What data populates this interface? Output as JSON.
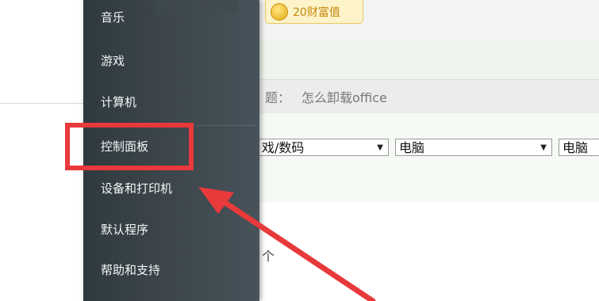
{
  "menu": {
    "items": [
      {
        "label": "音乐"
      },
      {
        "label": "游戏"
      },
      {
        "label": "计算机"
      },
      {
        "label": "控制面板"
      },
      {
        "label": "设备和打印机"
      },
      {
        "label": "默认程序"
      },
      {
        "label": "帮助和支持"
      }
    ],
    "highlighted_item": "控制面板"
  },
  "header": {
    "coin_badge": "20财富值"
  },
  "question": {
    "title_label": "题：",
    "title_value": "怎么卸载office"
  },
  "category": {
    "selects": [
      {
        "value": "戏/数码"
      },
      {
        "value": "电脑"
      },
      {
        "value": "电脑"
      }
    ]
  },
  "count_text": "个",
  "annotation": {
    "color": "#e8393b"
  }
}
